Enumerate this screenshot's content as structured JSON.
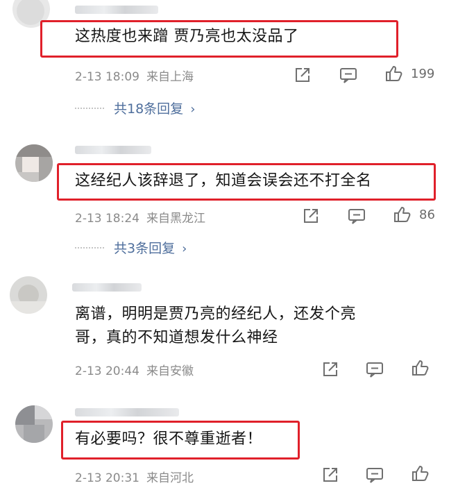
{
  "comments": [
    {
      "text": "这热度也来蹭 贾乃亮也太没品了",
      "time": "2-13 18:09",
      "location": "来自上海",
      "likes": "199",
      "replies": "共18条回复"
    },
    {
      "text": "这经纪人该辞退了，知道会误会还不打全名",
      "time": "2-13 18:24",
      "location": "来自黑龙江",
      "likes": "86",
      "replies": "共3条回复"
    },
    {
      "text_line1": "离谱，明明是贾乃亮的经纪人，还发个亮",
      "text_line2": "哥，真的不知道想发什么神经",
      "time": "2-13 20:44",
      "location": "来自安徽"
    },
    {
      "text": "有必要吗？很不尊重逝者！",
      "time": "2-13 20:31",
      "location": "来自河北"
    }
  ],
  "chevron": "›",
  "colors": {
    "highlight": "#e0202a",
    "link": "#4e6e9c",
    "meta": "#8a8a8a"
  },
  "icons": [
    "share-icon",
    "comment-icon",
    "like-icon",
    "chevron-right-icon"
  ]
}
